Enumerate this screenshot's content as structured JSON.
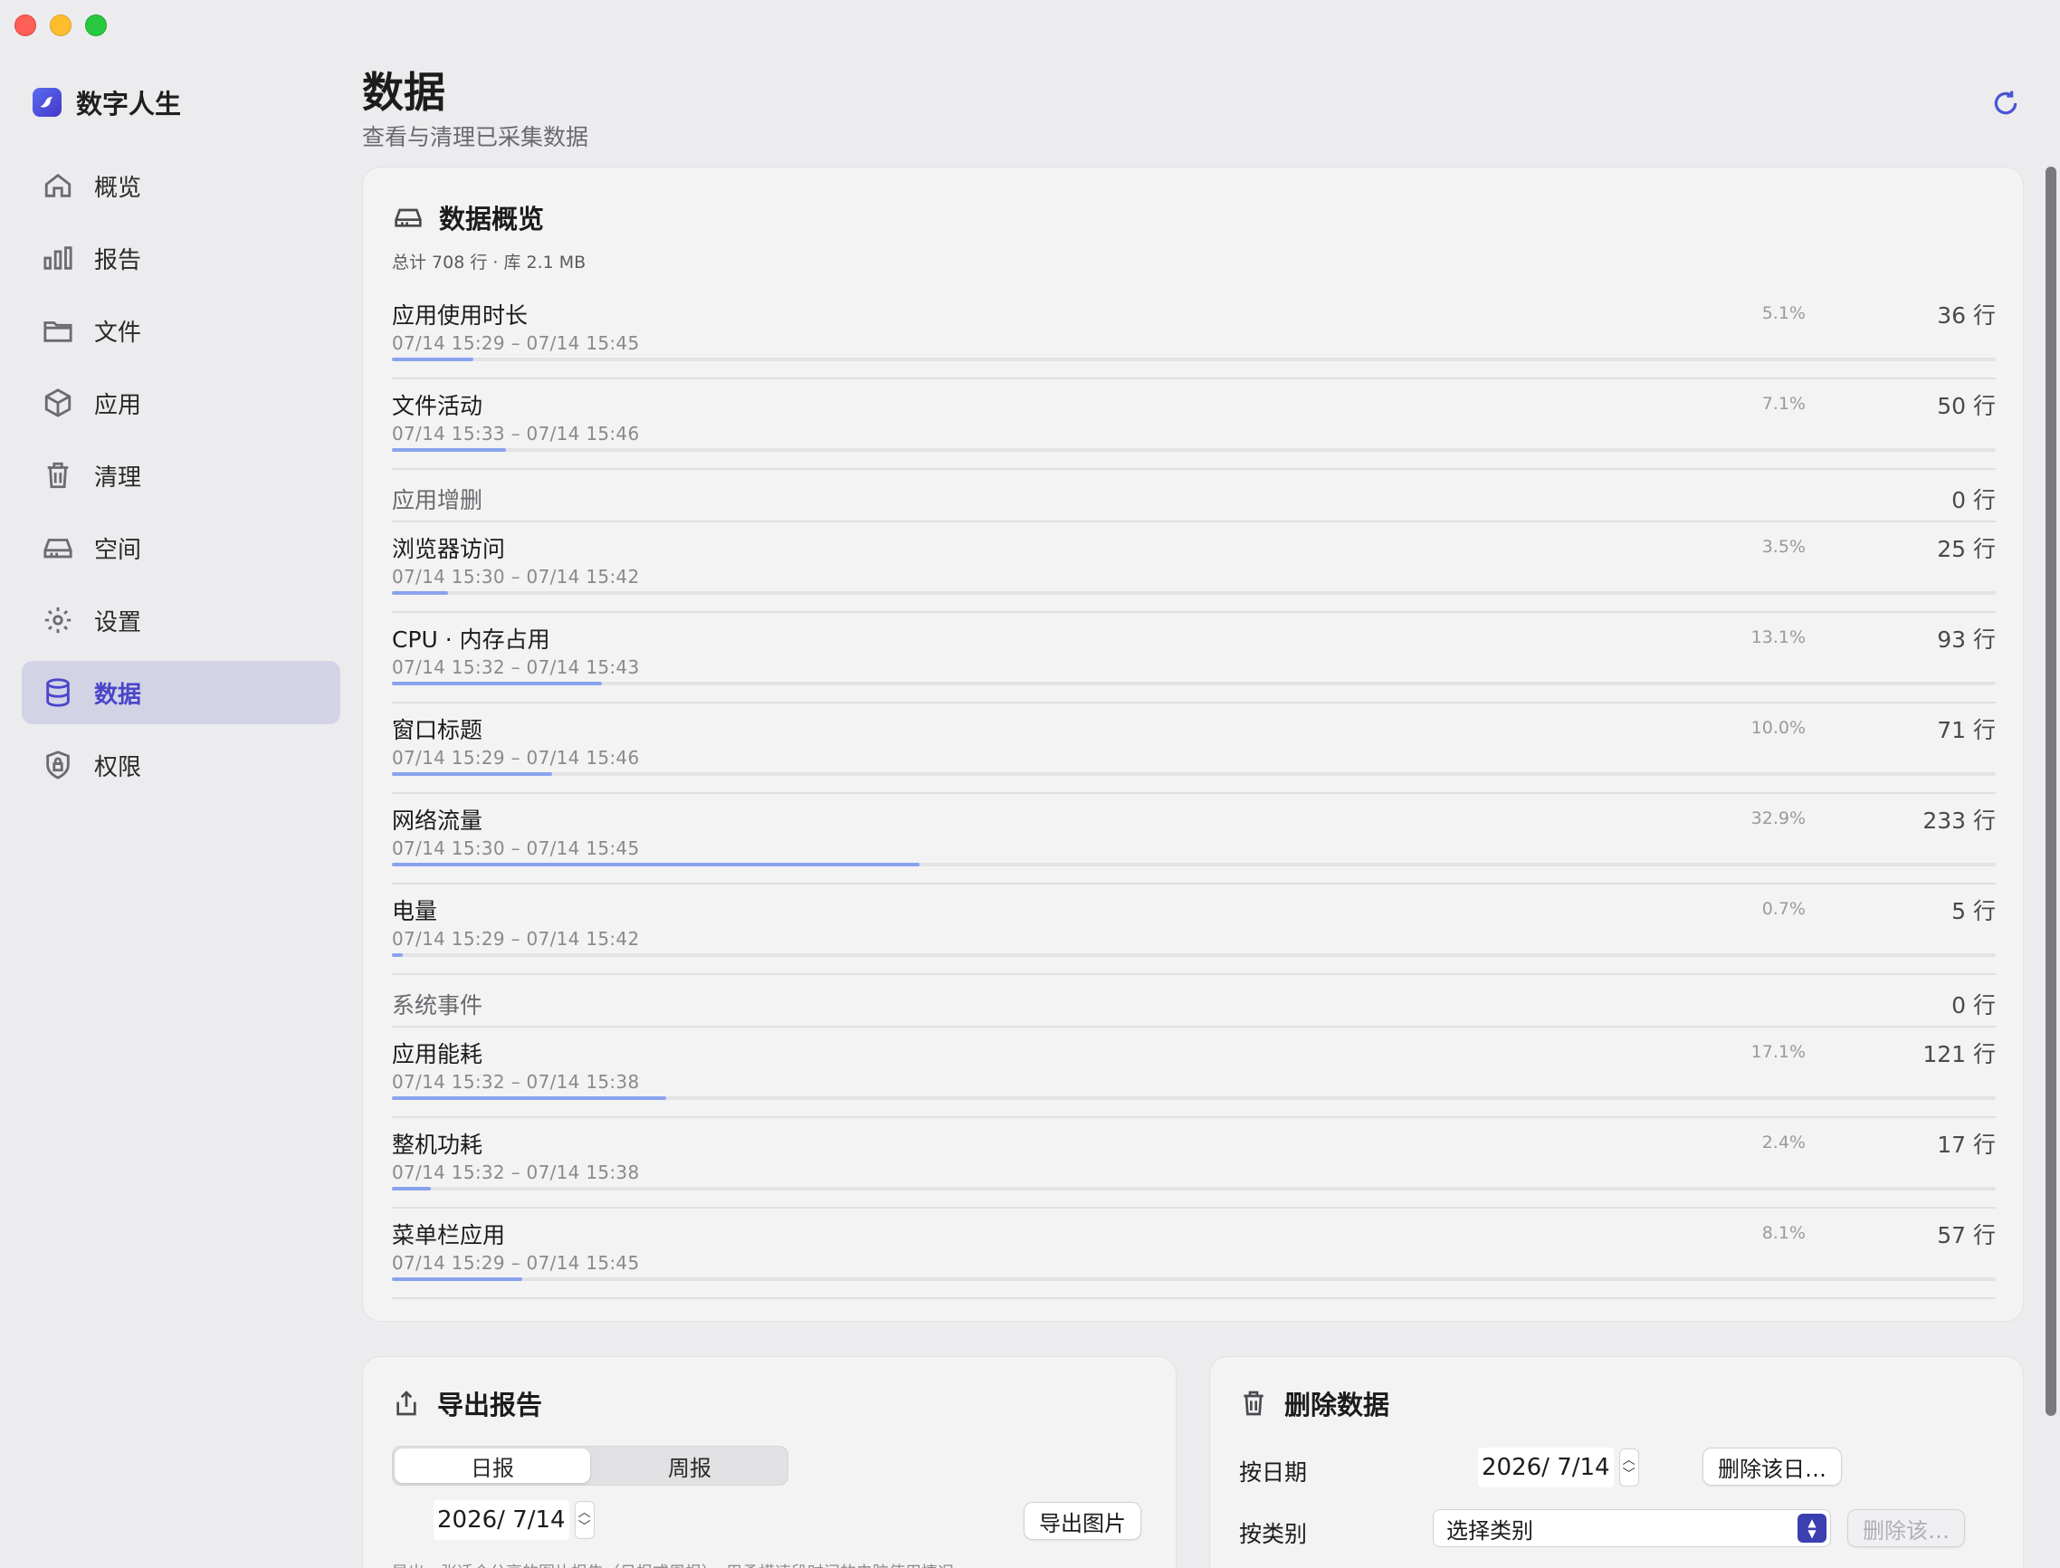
{
  "app": {
    "title": "数字人生"
  },
  "sidebar": {
    "items": [
      {
        "label": "概览",
        "icon": "house-icon"
      },
      {
        "label": "报告",
        "icon": "bar-chart-icon"
      },
      {
        "label": "文件",
        "icon": "folder-icon"
      },
      {
        "label": "应用",
        "icon": "package-icon"
      },
      {
        "label": "清理",
        "icon": "trash-icon"
      },
      {
        "label": "空间",
        "icon": "drive-icon"
      },
      {
        "label": "设置",
        "icon": "gear-icon"
      },
      {
        "label": "数据",
        "icon": "database-icon",
        "active": true
      },
      {
        "label": "权限",
        "icon": "shield-icon"
      }
    ]
  },
  "header": {
    "title": "数据",
    "subtitle": "查看与清理已采集数据"
  },
  "overview": {
    "title": "数据概览",
    "summary": "总计 708 行 · 库 2.1 MB",
    "rows": [
      {
        "name": "应用使用时长",
        "range": "07/14 15:29 – 07/14 15:45",
        "pct": "5.1%",
        "count": "36 行",
        "fraction": 0.051
      },
      {
        "name": "文件活动",
        "range": "07/14 15:33 – 07/14 15:46",
        "pct": "7.1%",
        "count": "50 行",
        "fraction": 0.071
      },
      {
        "name": "应用增删",
        "range": "",
        "pct": "",
        "count": "0 行",
        "fraction": 0
      },
      {
        "name": "浏览器访问",
        "range": "07/14 15:30 – 07/14 15:42",
        "pct": "3.5%",
        "count": "25 行",
        "fraction": 0.035
      },
      {
        "name": "CPU · 内存占用",
        "range": "07/14 15:32 – 07/14 15:43",
        "pct": "13.1%",
        "count": "93 行",
        "fraction": 0.131
      },
      {
        "name": "窗口标题",
        "range": "07/14 15:29 – 07/14 15:46",
        "pct": "10.0%",
        "count": "71 行",
        "fraction": 0.1
      },
      {
        "name": "网络流量",
        "range": "07/14 15:30 – 07/14 15:45",
        "pct": "32.9%",
        "count": "233 行",
        "fraction": 0.329
      },
      {
        "name": "电量",
        "range": "07/14 15:29 – 07/14 15:42",
        "pct": "0.7%",
        "count": "5 行",
        "fraction": 0.007
      },
      {
        "name": "系统事件",
        "range": "",
        "pct": "",
        "count": "0 行",
        "fraction": 0
      },
      {
        "name": "应用能耗",
        "range": "07/14 15:32 – 07/14 15:38",
        "pct": "17.1%",
        "count": "121 行",
        "fraction": 0.171
      },
      {
        "name": "整机功耗",
        "range": "07/14 15:32 – 07/14 15:38",
        "pct": "2.4%",
        "count": "17 行",
        "fraction": 0.024
      },
      {
        "name": "菜单栏应用",
        "range": "07/14 15:29 – 07/14 15:45",
        "pct": "8.1%",
        "count": "57 行",
        "fraction": 0.081
      }
    ]
  },
  "export": {
    "title": "导出报告",
    "tabs": [
      "日报",
      "周报"
    ],
    "date": "2026/  7/14",
    "button": "导出图片",
    "note": "导出一张适合分享的图片报告（日报或周报），用柔横速段时间的电脑使用情况"
  },
  "delete": {
    "title": "删除数据",
    "by_date_label": "按日期",
    "date": "2026/  7/14",
    "delete_day_button": "删除该日…",
    "by_category_label": "按类别",
    "category_placeholder": "选择类别",
    "delete_category_button": "删除该…"
  },
  "colors": {
    "accent": "#4a45c9",
    "bar": "#8aa3ef"
  }
}
